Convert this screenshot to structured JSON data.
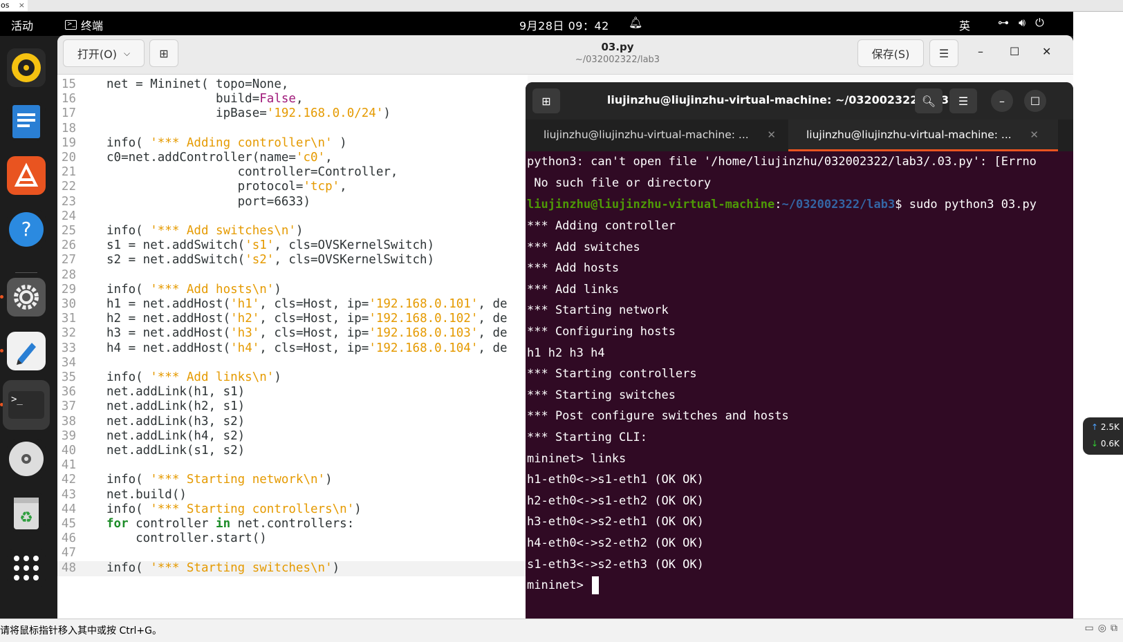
{
  "vm_tab": {
    "label": "os",
    "close": "×"
  },
  "topbar": {
    "activities": "活动",
    "app_name": "终端",
    "clock": "9月28日 09：42",
    "ime": "英"
  },
  "gedit": {
    "open_label": "打开(O)",
    "save_label": "保存(S)",
    "title": "03.py",
    "subtitle": "~/032002322/lab3",
    "lines": [
      {
        "n": "15",
        "html": "net = Mininet( topo=None,"
      },
      {
        "n": "16",
        "html": "               build=<span class='v'>False</span>,"
      },
      {
        "n": "17",
        "html": "               ipBase=<span class='s'>'192.168.0.0/24'</span>)"
      },
      {
        "n": "18",
        "html": ""
      },
      {
        "n": "19",
        "html": "info( <span class='s'>'*** Adding controller\\n'</span> )"
      },
      {
        "n": "20",
        "html": "c0=net.addController(name=<span class='s'>'c0'</span>,"
      },
      {
        "n": "21",
        "html": "                  controller=Controller,"
      },
      {
        "n": "22",
        "html": "                  protocol=<span class='s'>'tcp'</span>,"
      },
      {
        "n": "23",
        "html": "                  port=6633)"
      },
      {
        "n": "24",
        "html": ""
      },
      {
        "n": "25",
        "html": "info( <span class='s'>'*** Add switches\\n'</span>)"
      },
      {
        "n": "26",
        "html": "s1 = net.addSwitch(<span class='s'>'s1'</span>, cls=OVSKernelSwitch)"
      },
      {
        "n": "27",
        "html": "s2 = net.addSwitch(<span class='s'>'s2'</span>, cls=OVSKernelSwitch)"
      },
      {
        "n": "28",
        "html": ""
      },
      {
        "n": "29",
        "html": "info( <span class='s'>'*** Add hosts\\n'</span>)"
      },
      {
        "n": "30",
        "html": "h1 = net.addHost(<span class='s'>'h1'</span>, cls=Host, ip=<span class='s'>'192.168.0.101'</span>, de"
      },
      {
        "n": "31",
        "html": "h2 = net.addHost(<span class='s'>'h2'</span>, cls=Host, ip=<span class='s'>'192.168.0.102'</span>, de"
      },
      {
        "n": "32",
        "html": "h3 = net.addHost(<span class='s'>'h3'</span>, cls=Host, ip=<span class='s'>'192.168.0.103'</span>, de"
      },
      {
        "n": "33",
        "html": "h4 = net.addHost(<span class='s'>'h4'</span>, cls=Host, ip=<span class='s'>'192.168.0.104'</span>, de"
      },
      {
        "n": "34",
        "html": ""
      },
      {
        "n": "35",
        "html": "info( <span class='s'>'*** Add links\\n'</span>)"
      },
      {
        "n": "36",
        "html": "net.addLink(h1, s1)"
      },
      {
        "n": "37",
        "html": "net.addLink(h2, s1)"
      },
      {
        "n": "38",
        "html": "net.addLink(h3, s2)"
      },
      {
        "n": "39",
        "html": "net.addLink(h4, s2)"
      },
      {
        "n": "40",
        "html": "net.addLink(s1, s2)"
      },
      {
        "n": "41",
        "html": ""
      },
      {
        "n": "42",
        "html": "info( <span class='s'>'*** Starting network\\n'</span>)"
      },
      {
        "n": "43",
        "html": "net.build()"
      },
      {
        "n": "44",
        "html": "info( <span class='s'>'*** Starting controllers\\n'</span>)"
      },
      {
        "n": "45",
        "html": "<span class='k'>for</span> controller <span class='k'>in</span> net.controllers:"
      },
      {
        "n": "46",
        "html": "    controller.start()"
      },
      {
        "n": "47",
        "html": ""
      },
      {
        "n": "48",
        "html": "info( <span class='s'>'*** Starting switches\\n'</span>)"
      }
    ]
  },
  "terminal": {
    "title": "liujinzhu@liujinzhu-virtual-machine: ~/032002322/lab3",
    "tabs": [
      {
        "label": "liujinzhu@liujinzhu-virtual-machine: ..."
      },
      {
        "label": "liujinzhu@liujinzhu-virtual-machine: ..."
      }
    ],
    "prompt_user": "liujinzhu@liujinzhu-virtual-machine",
    "prompt_path": "~/032002322/lab3",
    "prompt_cmd": "$ sudo python3 03.py",
    "error_line1": "python3: can't open file '/home/liujinzhu/032002322/lab3/.03.py': [Errno",
    "error_line2": " No such file or directory",
    "output": [
      "*** Adding controller",
      "*** Add switches",
      "*** Add hosts",
      "*** Add links",
      "*** Starting network",
      "*** Configuring hosts",
      "h1 h2 h3 h4",
      "*** Starting controllers",
      "*** Starting switches",
      "*** Post configure switches and hosts",
      "*** Starting CLI:",
      "mininet> links",
      "h1-eth0<->s1-eth1 (OK OK)",
      "h2-eth0<->s1-eth2 (OK OK)",
      "h3-eth0<->s2-eth1 (OK OK)",
      "h4-eth0<->s2-eth2 (OK OK)",
      "s1-eth3<->s2-eth3 (OK OK)"
    ],
    "last_prompt": "mininet> "
  },
  "net_widget": {
    "up": "2.5K",
    "down": "0.6K"
  },
  "status": {
    "message": "请将鼠标指针移入其中或按 Ctrl+G。"
  }
}
